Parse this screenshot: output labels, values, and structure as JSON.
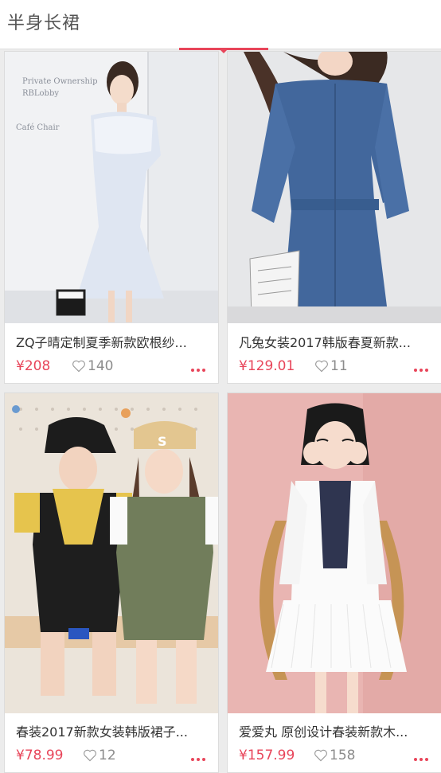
{
  "header": {
    "title": "半身长裙"
  },
  "products": [
    {
      "title": "ZQ子晴定制夏季新款欧根纱...",
      "price": "¥208",
      "likes": "140",
      "image": "girl-in-light-blue-mesh-dress"
    },
    {
      "title": "凡兔女装2017韩版春夏新款...",
      "price": "¥129.01",
      "likes": "11",
      "image": "girl-in-denim-shirt-dress"
    },
    {
      "title": "春装2017新款女装韩版裙子...",
      "price": "¥78.99",
      "likes": "12",
      "image": "two-girls-in-overall-dresses"
    },
    {
      "title": "爱爱丸 原创设计春装新款木...",
      "price": "¥157.99",
      "likes": "158",
      "image": "girl-in-white-pleated-dress"
    }
  ],
  "colors": {
    "accent": "#e8455a",
    "text": "#333333",
    "muted": "#8c8c8c",
    "background": "#ececec"
  }
}
